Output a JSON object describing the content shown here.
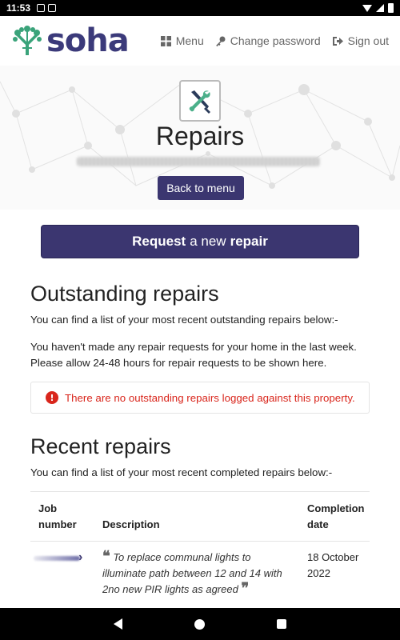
{
  "status_bar": {
    "time": "11:53"
  },
  "header": {
    "logo_text": "soha",
    "nav": [
      {
        "label": "Menu",
        "icon": "grid-icon"
      },
      {
        "label": "Change password",
        "icon": "key-icon"
      },
      {
        "label": "Sign out",
        "icon": "sign-out-icon"
      }
    ]
  },
  "hero": {
    "title": "Repairs",
    "back_button": "Back to menu"
  },
  "request_button": {
    "part1": "Request",
    "part2": "a new",
    "part3": "repair"
  },
  "outstanding": {
    "heading": "Outstanding repairs",
    "intro": "You can find a list of your most recent outstanding repairs below:-",
    "note": "You haven't made any repair requests for your home in the last week. Please allow 24-48 hours for repair requests to be shown here.",
    "alert": "There are no outstanding repairs logged against this property."
  },
  "recent": {
    "heading": "Recent repairs",
    "intro": "You can find a list of your most recent completed repairs below:-",
    "columns": [
      "Job number",
      "Description",
      "Completion date"
    ],
    "rows": [
      {
        "description": "To replace communal lights to illuminate path between 12 and 14 with 2no new PIR lights as agreed",
        "date": "18 October 2022"
      }
    ]
  },
  "colors": {
    "brand": "#3b3670",
    "alert": "#d9261c",
    "logo_green": "#3aa37a"
  }
}
